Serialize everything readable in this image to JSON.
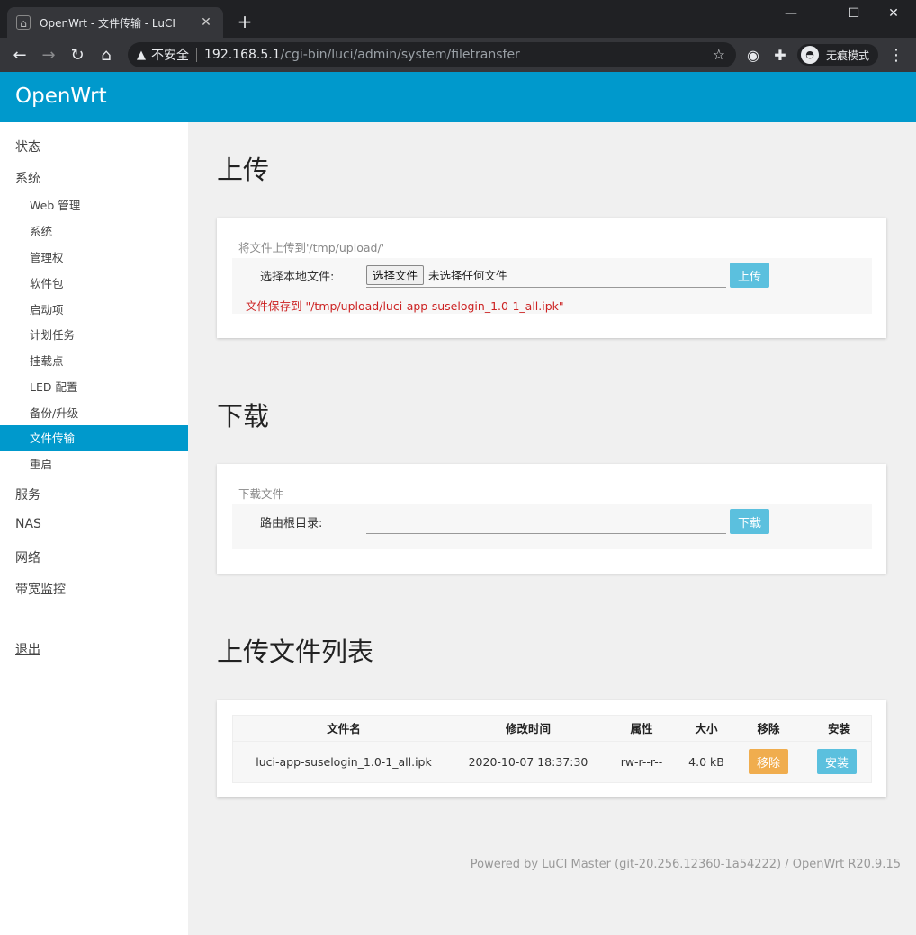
{
  "browser": {
    "tab_title": "OpenWrt - 文件传输 - LuCI",
    "not_secure": "不安全",
    "url_host": "192.168.5.1",
    "url_path": "/cgi-bin/luci/admin/system/filetransfer",
    "incognito_label": "无痕模式"
  },
  "header": {
    "brand": "OpenWrt"
  },
  "sidebar": {
    "top_items": [
      {
        "label": "状态"
      },
      {
        "label": "系统"
      }
    ],
    "system_sub": [
      {
        "label": "Web 管理"
      },
      {
        "label": "系统"
      },
      {
        "label": "管理权"
      },
      {
        "label": "软件包"
      },
      {
        "label": "启动项"
      },
      {
        "label": "计划任务"
      },
      {
        "label": "挂载点"
      },
      {
        "label": "LED 配置"
      },
      {
        "label": "备份/升级"
      },
      {
        "label": "文件传输",
        "active": true
      },
      {
        "label": "重启"
      }
    ],
    "bottom_items": [
      {
        "label": "服务"
      },
      {
        "label": "NAS"
      },
      {
        "label": "网络"
      },
      {
        "label": "带宽监控"
      }
    ],
    "logout": "退出"
  },
  "upload": {
    "heading": "上传",
    "legend": "将文件上传到'/tmp/upload/'",
    "field_label": "选择本地文件:",
    "choose_btn": "选择文件",
    "no_file": "未选择任何文件",
    "submit": "上传",
    "message": "文件保存到 \"/tmp/upload/luci-app-suselogin_1.0-1_all.ipk\""
  },
  "download": {
    "heading": "下载",
    "legend": "下载文件",
    "field_label": "路由根目录:",
    "input_value": "",
    "submit": "下载"
  },
  "filelist": {
    "heading": "上传文件列表",
    "columns": [
      "文件名",
      "修改时间",
      "属性",
      "大小",
      "移除",
      "安装"
    ],
    "rows": [
      {
        "name": "luci-app-suselogin_1.0-1_all.ipk",
        "mtime": "2020-10-07 18:37:30",
        "attr": "rw-r--r--",
        "size": "4.0 kB",
        "remove": "移除",
        "install": "安装"
      }
    ]
  },
  "footer": "Powered by LuCI Master (git-20.256.12360-1a54222) / OpenWrt R20.9.15",
  "colors": {
    "brand_blue": "#0099cc",
    "button_blue": "#5bc0de",
    "button_orange": "#f0ad4e",
    "message_red": "#cc2222"
  }
}
